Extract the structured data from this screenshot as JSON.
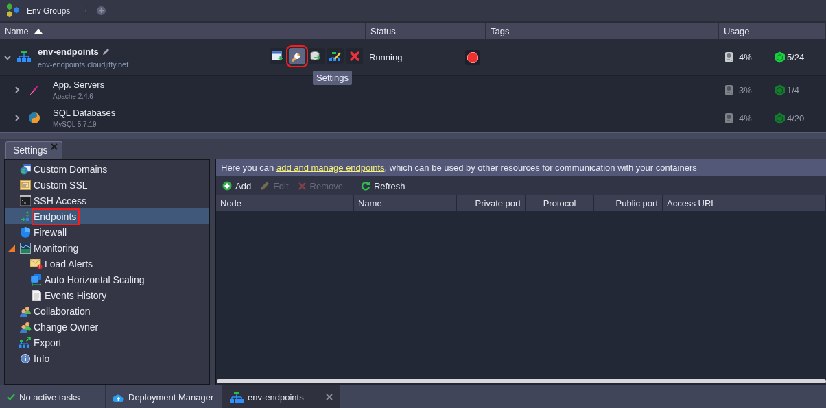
{
  "breadcrumb": {
    "title": "Env Groups"
  },
  "columns": [
    {
      "label": "Name",
      "sort_ascending": true
    },
    {
      "label": "Status",
      "sort_ascending": false
    },
    {
      "label": "Tags",
      "sort_ascending": false
    },
    {
      "label": "Usage",
      "sort_ascending": false
    }
  ],
  "environment": {
    "name": "env-endpoints",
    "domain": "env-endpoints.cloudjiffy.net",
    "expanded": true,
    "status": "Running",
    "disk": "4%",
    "cloudlets": "5/24",
    "actions": [
      {
        "kind": "open",
        "selected": false
      },
      {
        "kind": "settings",
        "selected": true
      },
      {
        "kind": "clone",
        "selected": false
      },
      {
        "kind": "topology",
        "selected": false
      },
      {
        "kind": "delete",
        "selected": false
      }
    ],
    "tooltip": "Settings",
    "nodes": [
      {
        "kind": "apache",
        "name": "App. Servers",
        "version": "Apache 2.4.6",
        "expanded": false,
        "disk": "3%",
        "cloudlets": "1/4"
      },
      {
        "kind": "mysql",
        "name": "SQL Databases",
        "version": "MySQL 5.7.19",
        "expanded": false,
        "disk": "4%",
        "cloudlets": "4/20"
      }
    ]
  },
  "settings_tab": {
    "label": "Settings",
    "closable": true
  },
  "menu": [
    {
      "kind": "domains",
      "label": "Custom Domains",
      "selected": false
    },
    {
      "kind": "ssl",
      "label": "Custom SSL",
      "selected": false
    },
    {
      "kind": "ssh",
      "label": "SSH Access",
      "selected": false
    },
    {
      "kind": "endpoints",
      "label": "Endpoints",
      "selected": true
    },
    {
      "kind": "firewall",
      "label": "Firewall",
      "selected": false
    },
    {
      "kind": "monitoring",
      "label": "Monitoring",
      "selected": false,
      "expanded": true,
      "children": [
        {
          "kind": "alerts",
          "label": "Load Alerts",
          "selected": false
        },
        {
          "kind": "scaling",
          "label": "Auto Horizontal Scaling",
          "selected": false
        },
        {
          "kind": "history",
          "label": "Events History",
          "selected": false
        }
      ]
    },
    {
      "kind": "collaboration",
      "label": "Collaboration",
      "selected": false
    },
    {
      "kind": "owner",
      "label": "Change Owner",
      "selected": false
    },
    {
      "kind": "export",
      "label": "Export",
      "selected": false
    },
    {
      "kind": "info",
      "label": "Info",
      "selected": false
    }
  ],
  "info": {
    "before": "Here you can ",
    "link": "add and manage endpoints",
    "after": ", which can be used by other resources for communication with your containers"
  },
  "toolbar": [
    {
      "kind": "add",
      "label": "Add",
      "disabled": false
    },
    {
      "kind": "edit",
      "label": "Edit",
      "disabled": true
    },
    {
      "kind": "remove",
      "label": "Remove",
      "disabled": true
    },
    {
      "kind": "refresh",
      "label": "Refresh",
      "disabled": false
    }
  ],
  "table": {
    "columns": [
      "Node",
      "Name",
      "Private port",
      "Protocol",
      "Public port",
      "Access URL"
    ]
  },
  "status_bar": [
    {
      "kind": "tasks",
      "label": "No active tasks",
      "selected": false,
      "closable": false
    },
    {
      "kind": "deploy",
      "label": "Deployment Manager",
      "selected": false,
      "closable": false
    },
    {
      "kind": "env",
      "label": "env-endpoints",
      "selected": true,
      "closable": true
    }
  ]
}
